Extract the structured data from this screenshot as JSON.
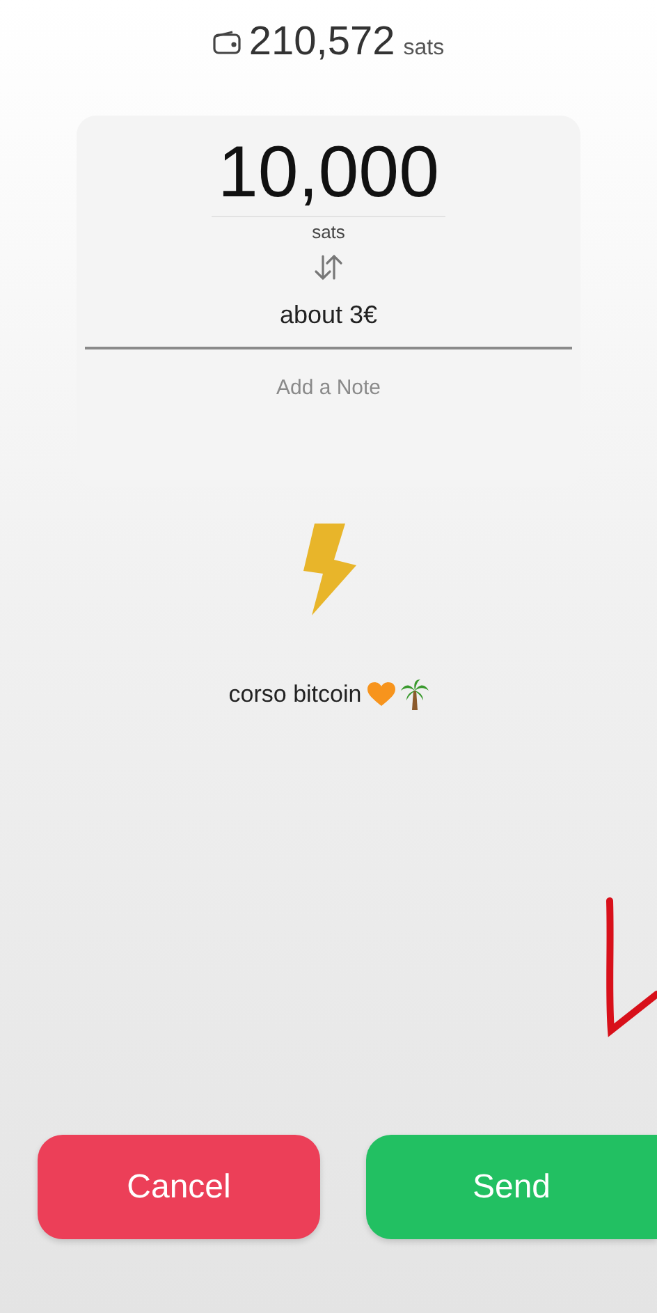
{
  "balance": {
    "amount": "210,572",
    "unit": "sats"
  },
  "amount": {
    "value": "10,000",
    "unit": "sats"
  },
  "fiat": "about 3€",
  "note": {
    "placeholder": "Add a Note"
  },
  "description": "corso bitcoin",
  "buttons": [
    {
      "label": "Cancel",
      "kind": "cancel"
    },
    {
      "label": "Send",
      "kind": "send"
    }
  ]
}
